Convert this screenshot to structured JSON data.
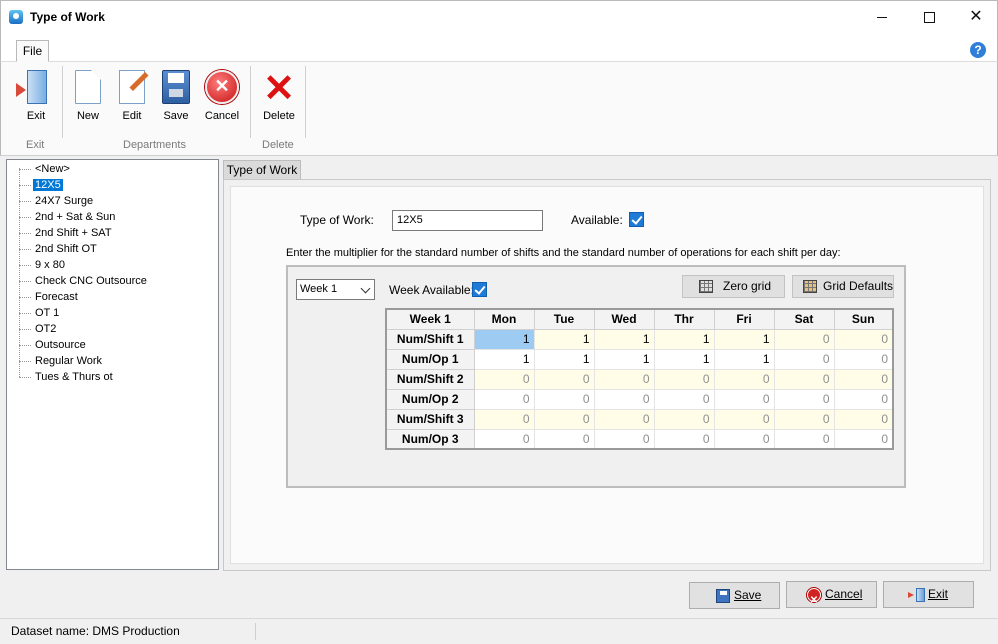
{
  "window": {
    "title": "Type of Work"
  },
  "menu": {
    "file": "File"
  },
  "ribbon": {
    "exit": "Exit",
    "new": "New",
    "edit": "Edit",
    "save": "Save",
    "cancel": "Cancel",
    "delete": "Delete",
    "group_exit": "Exit",
    "group_departments": "Departments",
    "group_delete": "Delete"
  },
  "tree": {
    "items": [
      "<New>",
      "12X5",
      "24X7 Surge",
      "2nd + Sat & Sun",
      "2nd Shift + SAT",
      "2nd Shift OT",
      "9 x 80",
      "Check CNC Outsource",
      "Forecast",
      "OT 1",
      "OT2",
      "Outsource",
      "Regular Work",
      "Tues & Thurs ot"
    ],
    "selected": "12X5"
  },
  "tab": {
    "label": "Type of Work"
  },
  "form": {
    "type_label": "Type of Work:",
    "type_value": "12X5",
    "available_label": "Available:",
    "available_checked": true,
    "instruction": "Enter the multiplier for the standard number of shifts and the standard number of operations for each shift per day:",
    "week_select": "Week 1",
    "week_available_label": "Week Available:",
    "week_available_checked": true,
    "zero_grid": "Zero grid",
    "grid_defaults": "Grid Defaults"
  },
  "grid": {
    "headers": [
      "Week 1",
      "Mon",
      "Tue",
      "Wed",
      "Thr",
      "Fri",
      "Sat",
      "Sun"
    ],
    "rows": [
      {
        "label": "Num/Shift 1",
        "values": [
          "1",
          "1",
          "1",
          "1",
          "1",
          "0",
          "0"
        ]
      },
      {
        "label": "Num/Op 1",
        "values": [
          "1",
          "1",
          "1",
          "1",
          "1",
          "0",
          "0"
        ]
      },
      {
        "label": "Num/Shift 2",
        "values": [
          "0",
          "0",
          "0",
          "0",
          "0",
          "0",
          "0"
        ]
      },
      {
        "label": "Num/Op 2",
        "values": [
          "0",
          "0",
          "0",
          "0",
          "0",
          "0",
          "0"
        ]
      },
      {
        "label": "Num/Shift 3",
        "values": [
          "0",
          "0",
          "0",
          "0",
          "0",
          "0",
          "0"
        ]
      },
      {
        "label": "Num/Op 3",
        "values": [
          "0",
          "0",
          "0",
          "0",
          "0",
          "0",
          "0"
        ]
      }
    ]
  },
  "footer": {
    "save": "Save",
    "cancel": "Cancel",
    "exit": "Exit"
  },
  "status": {
    "dataset": "Dataset name:  DMS Production"
  }
}
